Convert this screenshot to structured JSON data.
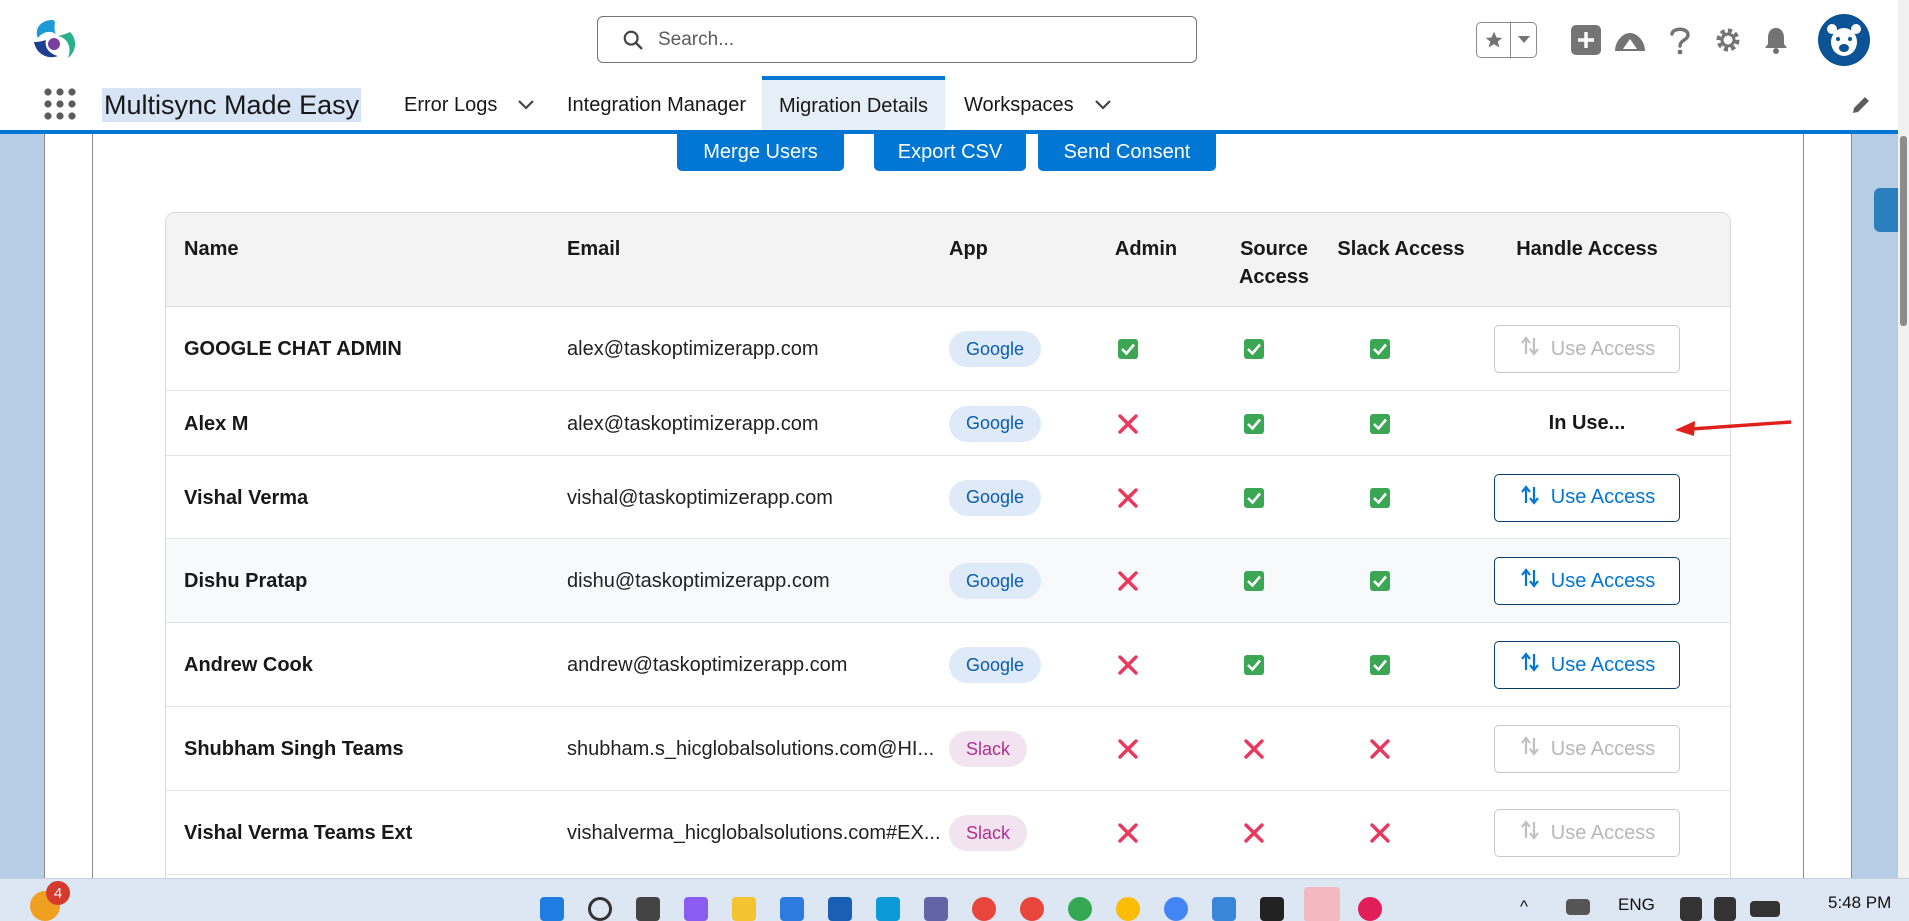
{
  "header": {
    "search_placeholder": "Search...",
    "icons": [
      "favorites-star-icon",
      "favorites-dropdown-icon",
      "add-icon",
      "trailhead-icon",
      "help-icon",
      "settings-gear-icon",
      "notification-bell-icon",
      "user-avatar"
    ]
  },
  "nav": {
    "app_name": "Multisync Made Easy",
    "items": [
      {
        "label": "Error Logs",
        "has_dropdown": true,
        "active": false
      },
      {
        "label": "Integration Manager",
        "has_dropdown": false,
        "active": false
      },
      {
        "label": "Migration Details",
        "has_dropdown": false,
        "active": true
      },
      {
        "label": "Workspaces",
        "has_dropdown": true,
        "active": false
      }
    ]
  },
  "actions": {
    "merge_users": "Merge Users",
    "export_csv": "Export CSV",
    "send_consent": "Send Consent"
  },
  "table": {
    "columns": {
      "name": "Name",
      "email": "Email",
      "app": "App",
      "admin": "Admin",
      "source_access_1": "Source",
      "source_access_2": "Access",
      "slack_access": "Slack Access",
      "handle_access": "Handle Access"
    },
    "use_access_label": "Use Access",
    "in_use_label": "In Use...",
    "rows": [
      {
        "name": "GOOGLE CHAT ADMIN",
        "email": "alex@taskoptimizerapp.com",
        "app": "Google",
        "admin": true,
        "source_access": true,
        "slack_access": true,
        "handle": "disabled"
      },
      {
        "name": "Alex M",
        "email": "alex@taskoptimizerapp.com",
        "app": "Google",
        "admin": false,
        "source_access": true,
        "slack_access": true,
        "handle": "in_use"
      },
      {
        "name": "Vishal Verma",
        "email": "vishal@taskoptimizerapp.com",
        "app": "Google",
        "admin": false,
        "source_access": true,
        "slack_access": true,
        "handle": "enabled"
      },
      {
        "name": "Dishu Pratap",
        "email": "dishu@taskoptimizerapp.com",
        "app": "Google",
        "admin": false,
        "source_access": true,
        "slack_access": true,
        "handle": "enabled"
      },
      {
        "name": "Andrew Cook",
        "email": "andrew@taskoptimizerapp.com",
        "app": "Google",
        "admin": false,
        "source_access": true,
        "slack_access": true,
        "handle": "enabled"
      },
      {
        "name": "Shubham Singh Teams",
        "email": "shubham.s_hicglobalsolutions.com@HI...",
        "app": "Slack",
        "admin": false,
        "source_access": false,
        "slack_access": false,
        "handle": "disabled"
      },
      {
        "name": "Vishal Verma Teams Ext",
        "email": "vishalverma_hicglobalsolutions.com#EX...",
        "app": "Slack",
        "admin": false,
        "source_access": false,
        "slack_access": false,
        "handle": "disabled"
      }
    ]
  },
  "taskbar": {
    "notification_count": "4",
    "language": "ENG",
    "time": "5:48 PM"
  },
  "colors": {
    "brand_blue": "#0176d3",
    "check_green": "#2e844a",
    "cross_red": "#e8385e",
    "annotation_red": "#e0201c"
  }
}
